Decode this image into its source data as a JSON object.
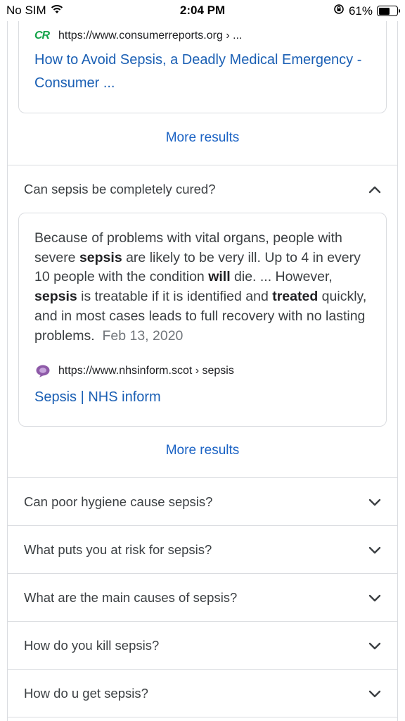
{
  "status_bar": {
    "carrier": "No SIM",
    "time": "2:04 PM",
    "battery_percent": "61%",
    "battery_level": 0.61
  },
  "top_result": {
    "source_url": "https://www.consumerreports.org › ...",
    "favicon_text": "CR",
    "title_line1": "How to Avoid Sepsis, a Deadly Medical Emergency -",
    "title_line2": "Consumer ..."
  },
  "more_results_label": "More results",
  "expanded_question": {
    "question": "Can sepsis be completely cured?",
    "answer_parts": [
      {
        "text": "Because of problems with vital organs, people with severe ",
        "bold": false
      },
      {
        "text": "sepsis",
        "bold": true
      },
      {
        "text": " are likely to be very ill. Up to 4 in every 10 people with the condition ",
        "bold": false
      },
      {
        "text": "will",
        "bold": true
      },
      {
        "text": " die. ... However, ",
        "bold": false
      },
      {
        "text": "sepsis",
        "bold": true
      },
      {
        "text": " is treatable if it is identified and ",
        "bold": false
      },
      {
        "text": "treated",
        "bold": true
      },
      {
        "text": " quickly, and in most cases leads to full recovery with no lasting problems.",
        "bold": false
      }
    ],
    "date": "Feb 13, 2020",
    "source_url": "https://www.nhsinform.scot › sepsis",
    "link_title": "Sepsis | NHS inform"
  },
  "collapsed_questions": [
    "Can poor hygiene cause sepsis?",
    "What puts you at risk for sepsis?",
    "What are the main causes of sepsis?",
    "How do you kill sepsis?",
    "How do u get sepsis?"
  ],
  "colors": {
    "link": "#1a5fb4",
    "more_results": "#1a62c4",
    "border": "#dadce0",
    "cr_brand": "#14a34a"
  }
}
